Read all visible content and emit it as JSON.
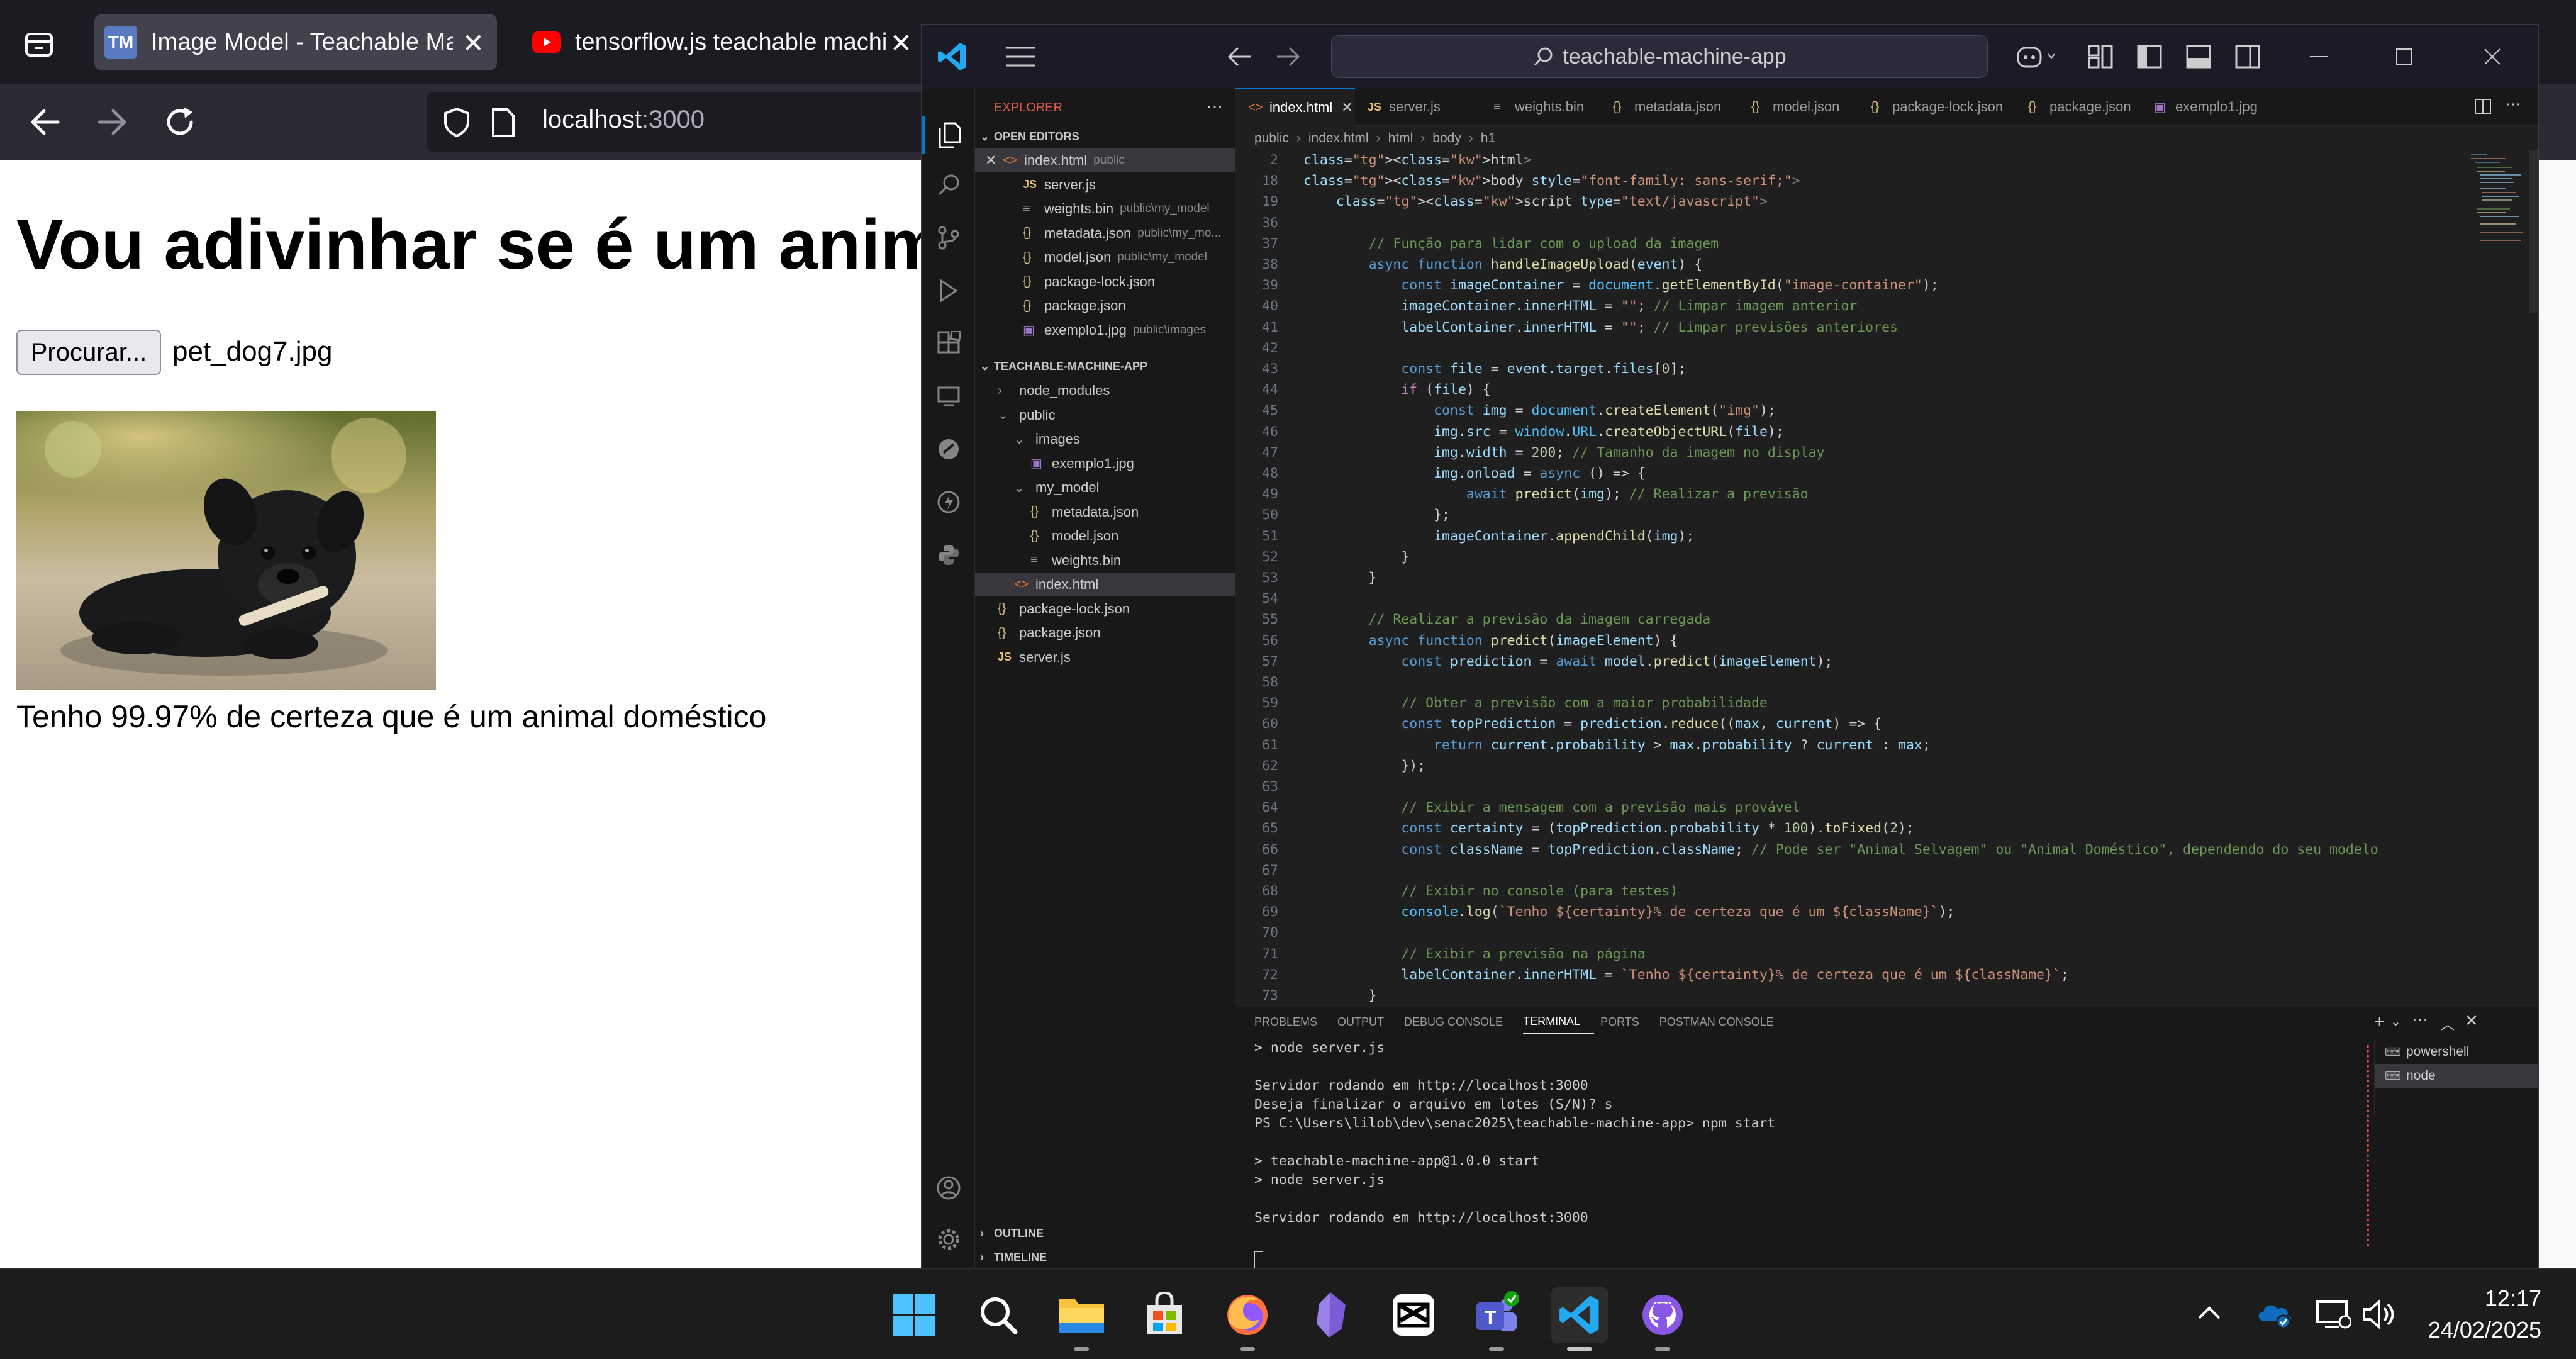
{
  "browser": {
    "tabs": [
      {
        "title": "Image Model - Teachable Machine",
        "favicon": "TM"
      },
      {
        "title": "tensorflow.js teachable machine",
        "favicon": "youtube-icon"
      }
    ],
    "url_host": "localhost",
    "url_port": ":3000"
  },
  "webpage": {
    "heading": "Vou adivinhar se é um animal doméstico ou selvagem",
    "browse_label": "Procurar...",
    "file_name": "pet_dog7.jpg",
    "result": "Tenho 99.97% de certeza que é um animal doméstico"
  },
  "vscode": {
    "search_placeholder": "teachable-machine-app",
    "explorer_title": "EXPLORER",
    "open_editors_title": "OPEN EDITORS",
    "project_title": "TEACHABLE-MACHINE-APP",
    "outline_title": "OUTLINE",
    "timeline_title": "TIMELINE",
    "open_editors": [
      {
        "name": "index.html",
        "hint": "public",
        "icon": "html"
      },
      {
        "name": "server.js",
        "hint": "",
        "icon": "js"
      },
      {
        "name": "weights.bin",
        "hint": "public\\my_model",
        "icon": "bin"
      },
      {
        "name": "metadata.json",
        "hint": "public\\my_mo...",
        "icon": "json"
      },
      {
        "name": "model.json",
        "hint": "public\\my_model",
        "icon": "json"
      },
      {
        "name": "package-lock.json",
        "hint": "",
        "icon": "json"
      },
      {
        "name": "package.json",
        "hint": "",
        "icon": "json"
      },
      {
        "name": "exemplo1.jpg",
        "hint": "public\\images",
        "icon": "img"
      }
    ],
    "tree": [
      {
        "name": "node_modules",
        "icon": "folder-closed"
      },
      {
        "name": "public",
        "icon": "folder-open"
      },
      {
        "name": "images",
        "icon": "folder-open"
      },
      {
        "name": "exemplo1.jpg",
        "icon": "img"
      },
      {
        "name": "my_model",
        "icon": "folder-open"
      },
      {
        "name": "metadata.json",
        "icon": "json"
      },
      {
        "name": "model.json",
        "icon": "json"
      },
      {
        "name": "weights.bin",
        "icon": "bin"
      },
      {
        "name": "index.html",
        "icon": "html"
      },
      {
        "name": "package-lock.json",
        "icon": "json"
      },
      {
        "name": "package.json",
        "icon": "json"
      },
      {
        "name": "server.js",
        "icon": "js"
      }
    ],
    "editor_tabs": [
      {
        "name": "index.html",
        "icon": "html"
      },
      {
        "name": "server.js",
        "icon": "js"
      },
      {
        "name": "weights.bin",
        "icon": "bin"
      },
      {
        "name": "metadata.json",
        "icon": "json"
      },
      {
        "name": "model.json",
        "icon": "json"
      },
      {
        "name": "package-lock.json",
        "icon": "json"
      },
      {
        "name": "package.json",
        "icon": "json"
      },
      {
        "name": "exemplo1.jpg",
        "icon": "img"
      }
    ],
    "breadcrumb": [
      "public",
      "index.html",
      "html",
      "body",
      "h1"
    ],
    "line_numbers": [
      "2",
      "18",
      "19",
      "36",
      "37",
      "38",
      "39",
      "40",
      "41",
      "42",
      "43",
      "44",
      "45",
      "46",
      "47",
      "48",
      "49",
      "50",
      "51",
      "52",
      "53",
      "54",
      "55",
      "56",
      "57",
      "58",
      "59",
      "60",
      "61",
      "62",
      "63",
      "64",
      "65",
      "66",
      "67",
      "68",
      "69",
      "70",
      "71",
      "72",
      "73"
    ],
    "code_lines": [
      "<html>",
      "<body style=\"font-family: sans-serif;\">",
      "    <script type=\"text/javascript\">",
      "",
      "        // Função para lidar com o upload da imagem",
      "        async function handleImageUpload(event) {",
      "            const imageContainer = document.getElementById(\"image-container\");",
      "            imageContainer.innerHTML = \"\"; // Limpar imagem anterior",
      "            labelContainer.innerHTML = \"\"; // Limpar previsões anteriores",
      "",
      "            const file = event.target.files[0];",
      "            if (file) {",
      "                const img = document.createElement(\"img\");",
      "                img.src = window.URL.createObjectURL(file);",
      "                img.width = 200; // Tamanho da imagem no display",
      "                img.onload = async () => {",
      "                    await predict(img); // Realizar a previsão",
      "                };",
      "                imageContainer.appendChild(img);",
      "            }",
      "        }",
      "",
      "        // Realizar a previsão da imagem carregada",
      "        async function predict(imageElement) {",
      "            const prediction = await model.predict(imageElement);",
      "",
      "            // Obter a previsão com a maior probabilidade",
      "            const topPrediction = prediction.reduce((max, current) => {",
      "                return current.probability > max.probability ? current : max;",
      "            });",
      "",
      "            // Exibir a mensagem com a previsão mais provável",
      "            const certainty = (topPrediction.probability * 100).toFixed(2);",
      "            const className = topPrediction.className; // Pode ser \"Animal Selvagem\" ou \"Animal Doméstico\", dependendo do seu modelo",
      "",
      "            // Exibir no console (para testes)",
      "            console.log(`Tenho ${certainty}% de certeza que é um ${className}`);",
      "",
      "            // Exibir a previsão na página",
      "            labelContainer.innerHTML = `Tenho ${certainty}% de certeza que é um ${className}`;",
      "        }"
    ],
    "panel_tabs": [
      "PROBLEMS",
      "OUTPUT",
      "DEBUG CONSOLE",
      "TERMINAL",
      "PORTS",
      "POSTMAN CONSOLE"
    ],
    "terminal_lines": [
      "> node server.js",
      "",
      "Servidor rodando em http://localhost:3000",
      "Deseja finalizar o arquivo em lotes (S/N)? s",
      "PS C:\\Users\\lilob\\dev\\senac2025\\teachable-machine-app> npm start",
      "",
      "> teachable-machine-app@1.0.0 start",
      "> node server.js",
      "",
      "Servidor rodando em http://localhost:3000"
    ],
    "terminal_list": [
      "powershell",
      "node"
    ]
  },
  "taskbar": {
    "time": "12:17",
    "date": "24/02/2025",
    "apps": [
      "start-icon",
      "search-icon",
      "file-explorer-icon",
      "store-icon",
      "firefox-icon",
      "obsidian-icon",
      "capcut-icon",
      "teams-icon",
      "vscode-icon",
      "github-desktop-icon"
    ]
  },
  "colors": {
    "accent": "#0078d4",
    "vscode_bg": "#1f1f1f",
    "browser_tab_bg": "#1c1b22"
  }
}
